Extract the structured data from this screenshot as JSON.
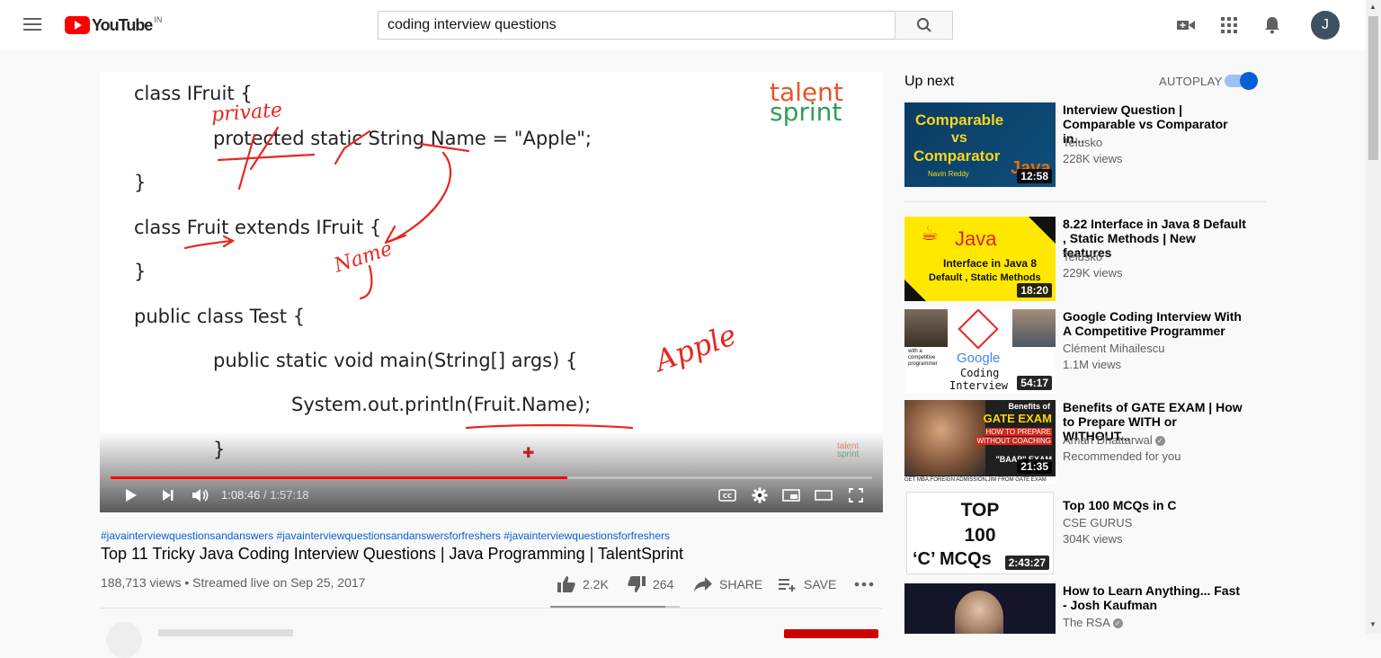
{
  "header": {
    "logo_text": "YouTube",
    "region": "IN",
    "search_value": "coding interview questions",
    "avatar_letter": "J"
  },
  "player": {
    "code_lines": [
      "class IFruit {",
      "protected static String Name = \"Apple\";",
      "}",
      "class Fruit extends IFruit {",
      "}",
      "public class Test {",
      "public static void main(String[] args) {",
      "System.out.println(Fruit.Name);",
      "}"
    ],
    "annotations": [
      "private",
      "Name",
      "Apple"
    ],
    "brand_top": "talent",
    "brand_bottom": "sprint",
    "time_current": "1:08:46",
    "time_separator": " / ",
    "time_total": "1:57:18",
    "progress": 0.6,
    "buffered": 0.61
  },
  "video": {
    "hashtags": "#javainterviewquestionsandanswers #javainterviewquestionsandanswersforfreshers #javainterviewquestionsforfreshers",
    "title": "Top 11 Tricky Java Coding Interview Questions | Java Programming | TalentSprint",
    "views_line": "188,713 views • Streamed live on Sep 25, 2017",
    "likes": "2.2K",
    "dislikes": "264",
    "share_label": "SHARE",
    "save_label": "SAVE",
    "like_ratio": 0.89
  },
  "sidebar": {
    "upnext_label": "Up next",
    "autoplay_label": "AUTOPLAY",
    "autoplay_on": true,
    "recommendations": [
      {
        "title": "Interview Question | Comparable vs Comparator in...",
        "channel": "Telusko",
        "views": "228K views",
        "duration": "12:58",
        "thumb_text": [
          "Comparable",
          "vs",
          "Comparator",
          "Navin Reddy",
          "Java"
        ]
      },
      {
        "title": "8.22 Interface in Java 8 Default , Static Methods | New features",
        "channel": "Telusko",
        "views": "229K views",
        "duration": "18:20",
        "thumb_text": [
          "Java",
          "Interface in Java 8",
          "Default , Static Methods"
        ]
      },
      {
        "title": "Google Coding Interview With A Competitive Programmer",
        "channel": "Clément Mihailescu",
        "views": "1.1M views",
        "duration": "54:17",
        "thumb_text": [
          "with a competitive programmer",
          "Google",
          "Coding",
          "Interview"
        ]
      },
      {
        "title": "Benefits of GATE EXAM | How to Prepare WITH or WITHOUT...",
        "channel": "Aman Dhattarwal",
        "views": "Recommended for you",
        "duration": "21:35",
        "thumb_text": [
          "Benefits of",
          "GATE EXAM",
          "HOW TO PREPARE",
          "WITHOUT COACHING",
          "\"BAAP\" EXAM",
          "GET MBA,FOREIGN ADMISSION,JIM FROM GATE EXAM"
        ]
      },
      {
        "title": "Top 100 MCQs in C",
        "channel": "CSE GURUS",
        "views": "304K views",
        "duration": "2:43:27",
        "thumb_text": [
          "TOP",
          "100",
          "‘C’ MCQs"
        ]
      },
      {
        "title": "How to Learn Anything... Fast - Josh Kaufman",
        "channel": "The RSA",
        "views": "",
        "duration": "",
        "thumb_text": []
      }
    ]
  },
  "colors": {
    "accent_red": "#ff0000",
    "link_blue": "#065fd4",
    "annotation_red": "#e8261f",
    "brand_orange": "#e8542b",
    "brand_green": "#2f9e5a"
  }
}
